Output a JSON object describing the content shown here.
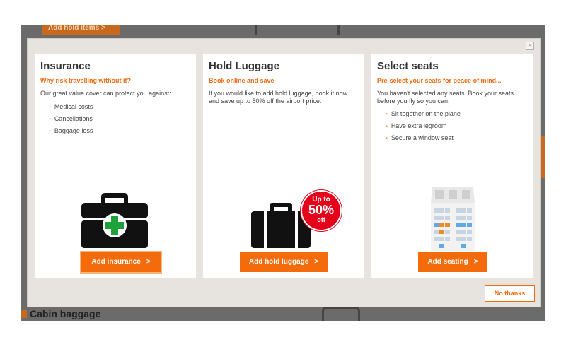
{
  "background": {
    "add_hold_label": "Add hold items  >",
    "cabin_label": "Cabin baggage"
  },
  "modal": {
    "close_label": "×",
    "no_thanks_label": "No thanks",
    "cards": [
      {
        "title": "Insurance",
        "subtitle": "Why risk travelling without it?",
        "description": "Our great value cover can protect you against:",
        "bullets": [
          "Medical costs",
          "Cancellations",
          "Baggage loss"
        ],
        "button_label": "Add insurance",
        "icon": "first-aid-kit-icon"
      },
      {
        "title": "Hold Luggage",
        "subtitle": "Book online and save",
        "description": "If you would like to add hold luggage, book it now and save up to 50% off the airport price.",
        "bullets": [],
        "button_label": "Add hold luggage",
        "icon": "suitcase-icon",
        "badge": {
          "top": "Up to",
          "value": "50%",
          "bottom": "off"
        }
      },
      {
        "title": "Select seats",
        "subtitle": "Pre-select your seats for peace of mind...",
        "description": "You haven't selected any seats. Book your seats before you fly so you can:",
        "bullets": [
          "Sit together on the plane",
          "Have extra legroom",
          "Secure a window seat"
        ],
        "button_label": "Add seating",
        "icon": "seat-map-icon"
      }
    ]
  },
  "colors": {
    "accent": "#f36b0a",
    "subtitle": "#ee6a11",
    "badge": "#e4021b",
    "first_aid_cross": "#1fa13a"
  },
  "chevron": ">"
}
